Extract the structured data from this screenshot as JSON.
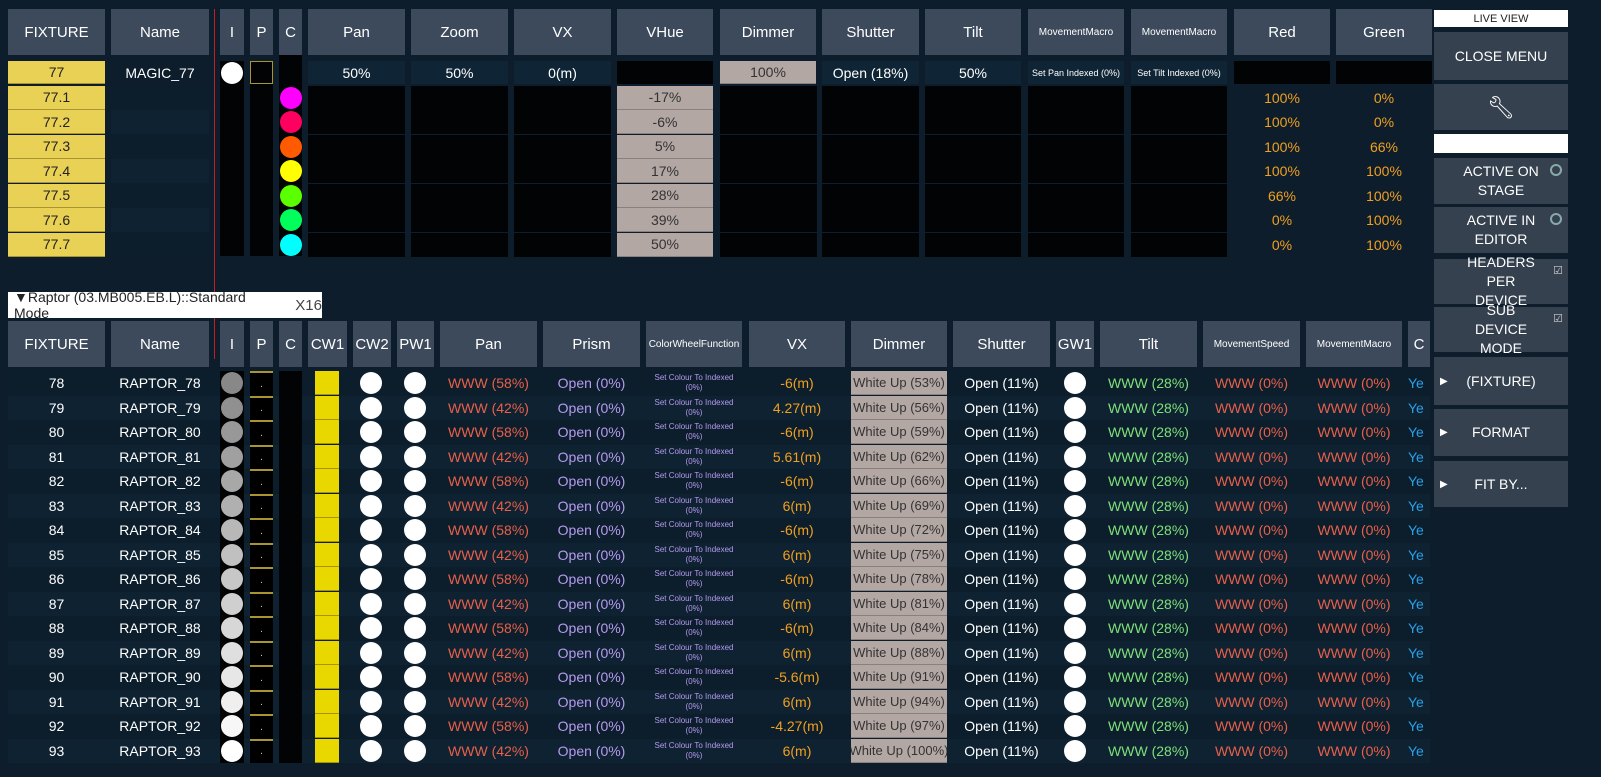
{
  "top": {
    "headers": [
      "FIXTURE",
      "Name",
      "I",
      "P",
      "C",
      "Pan",
      "Zoom",
      "VX",
      "VHue",
      "Dimmer",
      "Shutter",
      "Tilt",
      "MovementMacro",
      "MovementMacro",
      "Red",
      "Green"
    ],
    "main_row": {
      "fixture": "77",
      "name": "MAGIC_77",
      "pan": "50%",
      "zoom": "50%",
      "vx": "0(m)",
      "dimmer": "100%",
      "shutter": "Open (18%)",
      "tilt": "50%",
      "mm1": "Set Pan Indexed (0%)",
      "mm2": "Set Tilt Indexed (0%)"
    },
    "sub_rows": [
      {
        "fixture": "77.1",
        "color": "#ff00ff",
        "vhue": "-17%",
        "red": "100%",
        "green": "0%"
      },
      {
        "fixture": "77.2",
        "color": "#ff0060",
        "vhue": "-6%",
        "red": "100%",
        "green": "0%"
      },
      {
        "fixture": "77.3",
        "color": "#ff5a00",
        "vhue": "5%",
        "red": "100%",
        "green": "66%"
      },
      {
        "fixture": "77.4",
        "color": "#ffff00",
        "vhue": "17%",
        "red": "100%",
        "green": "100%"
      },
      {
        "fixture": "77.5",
        "color": "#5aff00",
        "vhue": "28%",
        "red": "66%",
        "green": "100%"
      },
      {
        "fixture": "77.6",
        "color": "#00ff5a",
        "vhue": "39%",
        "red": "0%",
        "green": "100%"
      },
      {
        "fixture": "77.7",
        "color": "#00ffff",
        "vhue": "50%",
        "red": "0%",
        "green": "100%"
      }
    ]
  },
  "group": {
    "label": "▼Raptor (03.MB005.EB.L)::Standard Mode",
    "count": "X16"
  },
  "bottom": {
    "headers": [
      "FIXTURE",
      "Name",
      "I",
      "P",
      "C",
      "CW1",
      "CW2",
      "PW1",
      "Pan",
      "Prism",
      "ColorWheelFunction",
      "VX",
      "Dimmer",
      "Shutter",
      "GW1",
      "Tilt",
      "MovementSpeed",
      "MovementMacro",
      "C"
    ],
    "rows": [
      {
        "fixture": "78",
        "name": "RAPTOR_78",
        "pan": "WWW (58%)",
        "vx": "-6(m)",
        "dimmer": "White Up (53%)"
      },
      {
        "fixture": "79",
        "name": "RAPTOR_79",
        "pan": "WWW (42%)",
        "vx": "4.27(m)",
        "dimmer": "White Up (56%)"
      },
      {
        "fixture": "80",
        "name": "RAPTOR_80",
        "pan": "WWW (58%)",
        "vx": "-6(m)",
        "dimmer": "White Up (59%)"
      },
      {
        "fixture": "81",
        "name": "RAPTOR_81",
        "pan": "WWW (42%)",
        "vx": "5.61(m)",
        "dimmer": "White Up (62%)"
      },
      {
        "fixture": "82",
        "name": "RAPTOR_82",
        "pan": "WWW (58%)",
        "vx": "-6(m)",
        "dimmer": "White Up (66%)"
      },
      {
        "fixture": "83",
        "name": "RAPTOR_83",
        "pan": "WWW (42%)",
        "vx": "6(m)",
        "dimmer": "White Up (69%)"
      },
      {
        "fixture": "84",
        "name": "RAPTOR_84",
        "pan": "WWW (58%)",
        "vx": "-6(m)",
        "dimmer": "White Up (72%)"
      },
      {
        "fixture": "85",
        "name": "RAPTOR_85",
        "pan": "WWW (42%)",
        "vx": "6(m)",
        "dimmer": "White Up (75%)"
      },
      {
        "fixture": "86",
        "name": "RAPTOR_86",
        "pan": "WWW (58%)",
        "vx": "-6(m)",
        "dimmer": "White Up (78%)"
      },
      {
        "fixture": "87",
        "name": "RAPTOR_87",
        "pan": "WWW (42%)",
        "vx": "6(m)",
        "dimmer": "White Up (81%)"
      },
      {
        "fixture": "88",
        "name": "RAPTOR_88",
        "pan": "WWW (58%)",
        "vx": "-6(m)",
        "dimmer": "White Up (84%)"
      },
      {
        "fixture": "89",
        "name": "RAPTOR_89",
        "pan": "WWW (42%)",
        "vx": "6(m)",
        "dimmer": "White Up (88%)"
      },
      {
        "fixture": "90",
        "name": "RAPTOR_90",
        "pan": "WWW (58%)",
        "vx": "-5.6(m)",
        "dimmer": "White Up (91%)"
      },
      {
        "fixture": "91",
        "name": "RAPTOR_91",
        "pan": "WWW (42%)",
        "vx": "6(m)",
        "dimmer": "White Up (94%)"
      },
      {
        "fixture": "92",
        "name": "RAPTOR_92",
        "pan": "WWW (58%)",
        "vx": "-4.27(m)",
        "dimmer": "White Up (97%)"
      },
      {
        "fixture": "93",
        "name": "RAPTOR_93",
        "pan": "WWW (42%)",
        "vx": "6(m)",
        "dimmer": "White Up (100%)"
      }
    ],
    "common": {
      "prism": "Open (0%)",
      "cwf_line1": "Set Colour  To Indexed",
      "cwf_line2": "(0%)",
      "shutter": "Open (11%)",
      "tilt": "WWW (28%)",
      "speed": "WWW (0%)",
      "macro": "WWW (0%)",
      "last": "Ye",
      "p_marker": "."
    }
  },
  "menu": {
    "live_view": "LIVE VIEW",
    "close_menu": "CLOSE MENU",
    "wrench_icon": "wrench",
    "active_on_stage": "ACTIVE ON STAGE",
    "active_in_editor": "ACTIVE IN EDITOR",
    "headers_per_device": "HEADERS PER DEVICE",
    "sub_device_mode": "SUB DEVICE MODE",
    "fixture": "(FIXTURE)",
    "format": "FORMAT",
    "fit_by": "FIT BY..."
  },
  "colors": {
    "fixture_yellow": "#e8d154",
    "header": "#3d4a5c",
    "value_orange": "#f0a020",
    "value_red": "#e8604a",
    "value_green": "#7ee07a",
    "value_purple": "#b69af0"
  }
}
